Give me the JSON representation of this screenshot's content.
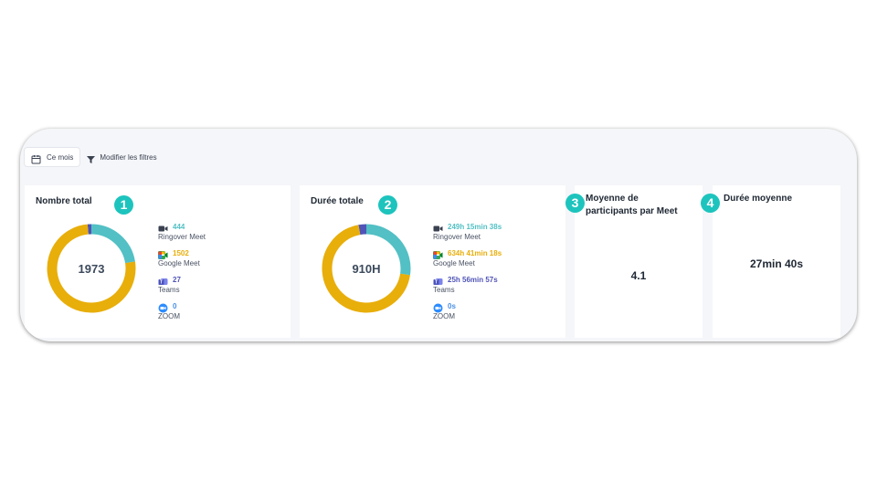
{
  "filters": {
    "period_label": "Ce mois",
    "modify_label": "Modifier les filtres"
  },
  "colors": {
    "ringover": "#52c0c4",
    "google_meet": "#e8ae0a",
    "teams": "#5054b7",
    "zoom": "#4a90e2",
    "badge": "#1dc4bd"
  },
  "cards": {
    "total_count": {
      "badge": "1",
      "title": "Nombre total",
      "center": "1973",
      "items": [
        {
          "value": "444",
          "name": "Ringover Meet",
          "icon": "ringover-video-icon"
        },
        {
          "value": "1502",
          "name": "Google Meet",
          "icon": "google-meet-icon"
        },
        {
          "value": "27",
          "name": "Teams",
          "icon": "teams-icon"
        },
        {
          "value": "0",
          "name": "ZOOM",
          "icon": "zoom-icon"
        }
      ],
      "shares": [
        444,
        1502,
        27,
        0
      ]
    },
    "total_duration": {
      "badge": "2",
      "title": "Durée totale",
      "center": "910H",
      "items": [
        {
          "value": "249h 15min 38s",
          "name": "Ringover Meet",
          "icon": "ringover-video-icon"
        },
        {
          "value": "634h 41min 18s",
          "name": "Google Meet",
          "icon": "google-meet-icon"
        },
        {
          "value": "25h 56min 57s",
          "name": "Teams",
          "icon": "teams-icon"
        },
        {
          "value": "0s",
          "name": "ZOOM",
          "icon": "zoom-icon"
        }
      ],
      "shares": [
        249.26,
        634.69,
        25.95,
        0
      ]
    },
    "avg_participants": {
      "badge": "3",
      "title_line1": "Moyenne de",
      "title_line2": "participants par Meet",
      "value": "4.1"
    },
    "avg_duration": {
      "badge": "4",
      "title": "Durée moyenne",
      "value": "27min 40s"
    }
  }
}
